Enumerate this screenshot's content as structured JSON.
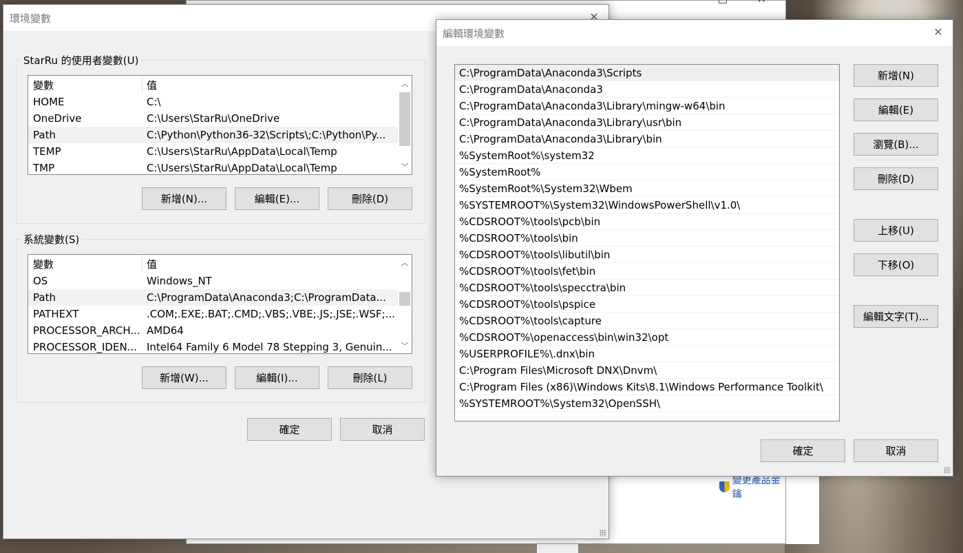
{
  "env_dialog": {
    "title": "環境變數",
    "user_group_label": "StarRu 的使用者變數(U)",
    "user_list": {
      "col_variable": "變數",
      "col_value": "值",
      "rows": [
        {
          "name": "HOME",
          "value": "C:\\"
        },
        {
          "name": "OneDrive",
          "value": "C:\\Users\\StarRu\\OneDrive"
        },
        {
          "name": "Path",
          "value": "C:\\Python\\Python36-32\\Scripts\\;C:\\Python\\Py..."
        },
        {
          "name": "TEMP",
          "value": "C:\\Users\\StarRu\\AppData\\Local\\Temp"
        },
        {
          "name": "TMP",
          "value": "C:\\Users\\StarRu\\AppData\\Local\\Temp"
        }
      ]
    },
    "user_buttons": {
      "new": "新增(N)...",
      "edit": "編輯(E)...",
      "delete": "刪除(D)"
    },
    "system_group_label": "系統變數(S)",
    "system_list": {
      "col_variable": "變數",
      "col_value": "值",
      "rows": [
        {
          "name": "OS",
          "value": "Windows_NT"
        },
        {
          "name": "Path",
          "value": "C:\\ProgramData\\Anaconda3;C:\\ProgramData..."
        },
        {
          "name": "PATHEXT",
          "value": ".COM;.EXE;.BAT;.CMD;.VBS;.VBE;.JS;.JSE;.WSF;..."
        },
        {
          "name": "PROCESSOR_ARCH...",
          "value": "AMD64"
        },
        {
          "name": "PROCESSOR_IDEN...",
          "value": "Intel64 Family 6 Model 78 Stepping 3, Genuin..."
        }
      ]
    },
    "system_buttons": {
      "new": "新增(W)...",
      "edit": "編輯(I)...",
      "delete": "刪除(L)"
    },
    "ok": "確定",
    "cancel": "取消"
  },
  "edit_dialog": {
    "title": "編輯環境變數",
    "paths": [
      "C:\\ProgramData\\Anaconda3\\Scripts",
      "C:\\ProgramData\\Anaconda3",
      "C:\\ProgramData\\Anaconda3\\Library\\mingw-w64\\bin",
      "C:\\ProgramData\\Anaconda3\\Library\\usr\\bin",
      "C:\\ProgramData\\Anaconda3\\Library\\bin",
      "%SystemRoot%\\system32",
      "%SystemRoot%",
      "%SystemRoot%\\System32\\Wbem",
      "%SYSTEMROOT%\\System32\\WindowsPowerShell\\v1.0\\",
      "%CDSROOT%\\tools\\pcb\\bin",
      "%CDSROOT%\\tools\\bin",
      "%CDSROOT%\\tools\\libutil\\bin",
      "%CDSROOT%\\tools\\fet\\bin",
      "%CDSROOT%\\tools\\specctra\\bin",
      "%CDSROOT%\\tools\\pspice",
      "%CDSROOT%\\tools\\capture",
      "%CDSROOT%\\openaccess\\bin\\win32\\opt",
      "%USERPROFILE%\\.dnx\\bin",
      "C:\\Program Files\\Microsoft DNX\\Dnvm\\",
      "C:\\Program Files (x86)\\Windows Kits\\8.1\\Windows Performance Toolkit\\",
      "%SYSTEMROOT%\\System32\\OpenSSH\\"
    ],
    "buttons": {
      "new": "新增(N)",
      "edit": "編輯(E)",
      "browse": "瀏覽(B)...",
      "delete": "刪除(D)",
      "move_up": "上移(U)",
      "move_down": "下移(O)",
      "edit_text": "編輯文字(T)..."
    },
    "ok": "確定",
    "cancel": "取消"
  },
  "background_window": {
    "link_text": "變更產品金鑰"
  }
}
